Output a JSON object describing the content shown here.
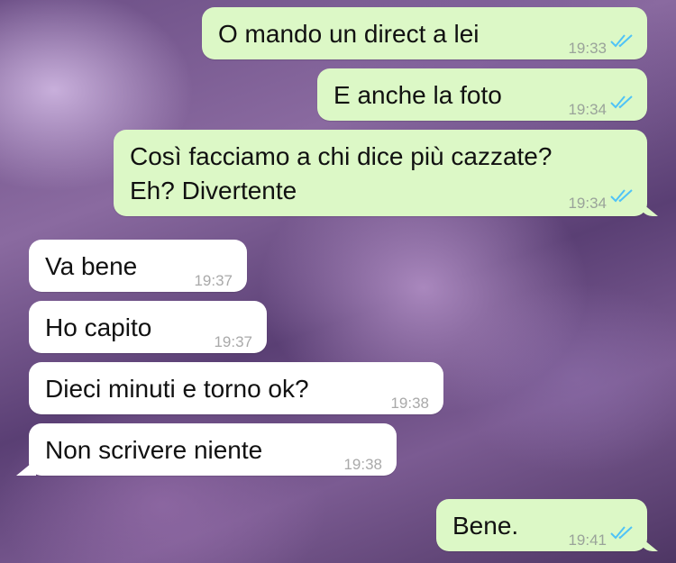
{
  "messages": [
    {
      "direction": "outgoing",
      "text": "O mando un direct a lei",
      "time": "19:33",
      "status_icon": "double-check-icon",
      "status_color": "#4fc3f7"
    },
    {
      "direction": "outgoing",
      "text": "E anche la foto",
      "time": "19:34",
      "status_icon": "double-check-icon",
      "status_color": "#4fc3f7"
    },
    {
      "direction": "outgoing",
      "lines": [
        "Così facciamo a chi dice più cazzate?",
        "Eh? Divertente"
      ],
      "time": "19:34",
      "status_icon": "double-check-icon",
      "status_color": "#4fc3f7"
    },
    {
      "direction": "incoming",
      "text": "Va bene",
      "time": "19:37"
    },
    {
      "direction": "incoming",
      "text": "Ho capito",
      "time": "19:37"
    },
    {
      "direction": "incoming",
      "text": "Dieci minuti e torno ok?",
      "time": "19:38"
    },
    {
      "direction": "incoming",
      "text": "Non scrivere niente",
      "time": "19:38"
    },
    {
      "direction": "outgoing",
      "text": "Bene.",
      "time": "19:41",
      "status_icon": "double-check-icon",
      "status_color": "#4fc3f7"
    }
  ],
  "colors": {
    "outgoing_bubble": "#dcf8c6",
    "incoming_bubble": "#ffffff",
    "read_ticks": "#4fc3f7"
  }
}
